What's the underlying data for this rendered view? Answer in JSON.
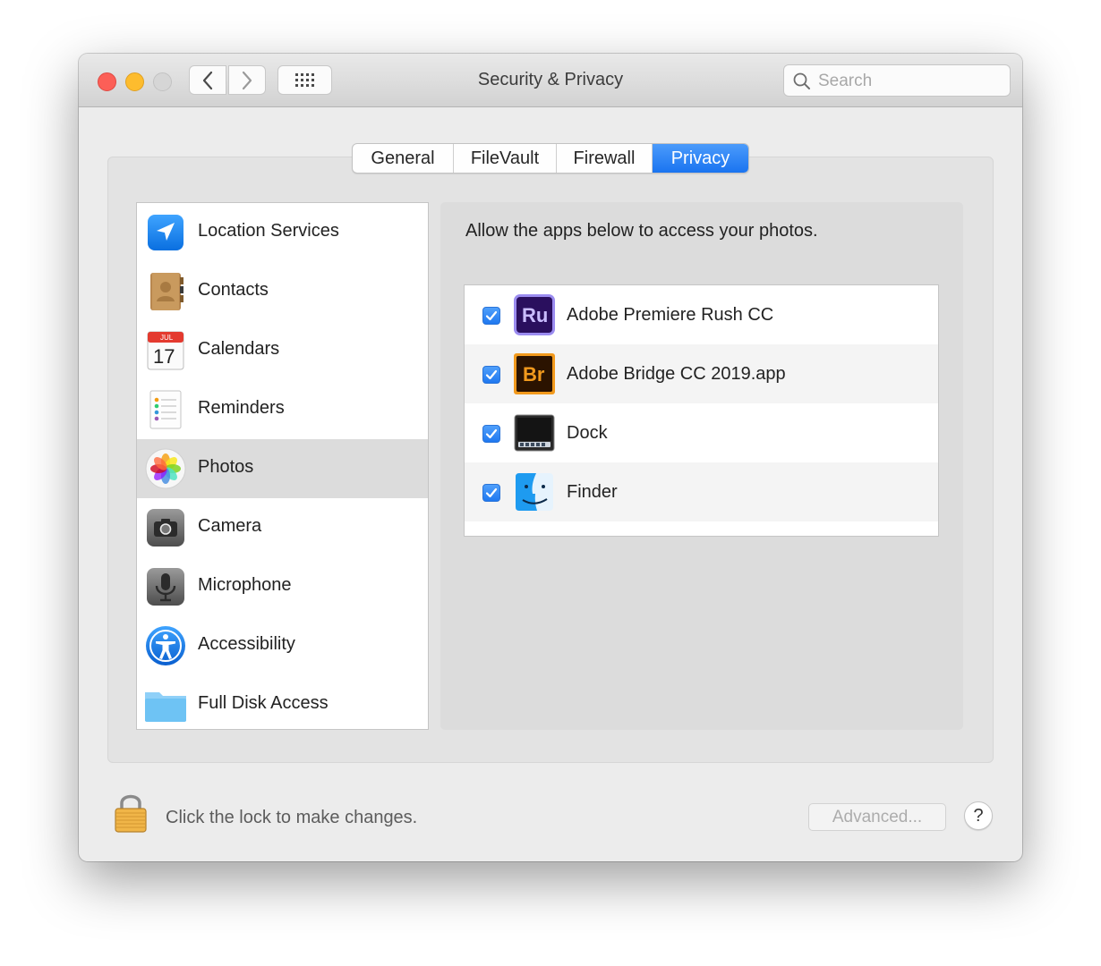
{
  "window": {
    "title": "Security & Privacy"
  },
  "search": {
    "placeholder": "Search"
  },
  "tabs": [
    {
      "label": "General"
    },
    {
      "label": "FileVault"
    },
    {
      "label": "Firewall"
    },
    {
      "label": "Privacy",
      "selected": true
    }
  ],
  "sidebar": {
    "items": [
      {
        "label": "Location Services",
        "icon": "location-arrow-icon"
      },
      {
        "label": "Contacts",
        "icon": "contacts-book-icon"
      },
      {
        "label": "Calendars",
        "icon": "calendar-icon",
        "icon_text": [
          "JUL",
          "17"
        ]
      },
      {
        "label": "Reminders",
        "icon": "reminders-list-icon"
      },
      {
        "label": "Photos",
        "icon": "photos-flower-icon",
        "selected": true
      },
      {
        "label": "Camera",
        "icon": "camera-icon"
      },
      {
        "label": "Microphone",
        "icon": "microphone-icon"
      },
      {
        "label": "Accessibility",
        "icon": "accessibility-icon"
      },
      {
        "label": "Full Disk Access",
        "icon": "folder-icon"
      }
    ]
  },
  "main": {
    "description": "Allow the apps below to access your photos.",
    "apps": [
      {
        "name": "Adobe Premiere Rush CC",
        "icon": "premiere-rush-icon",
        "icon_text": "Ru",
        "checked": true
      },
      {
        "name": "Adobe Bridge CC 2019.app",
        "icon": "bridge-icon",
        "icon_text": "Br",
        "checked": true
      },
      {
        "name": "Dock",
        "icon": "dock-icon",
        "checked": true
      },
      {
        "name": "Finder",
        "icon": "finder-icon",
        "checked": true
      }
    ]
  },
  "footer": {
    "lock_text": "Click the lock to make changes.",
    "advanced_label": "Advanced...",
    "help_label": "?"
  },
  "colors": {
    "accent": "#1a74f0",
    "rush_purple": "#2a0f5e",
    "bridge_brown": "#2b1300",
    "bridge_orange": "#f29a1d"
  }
}
